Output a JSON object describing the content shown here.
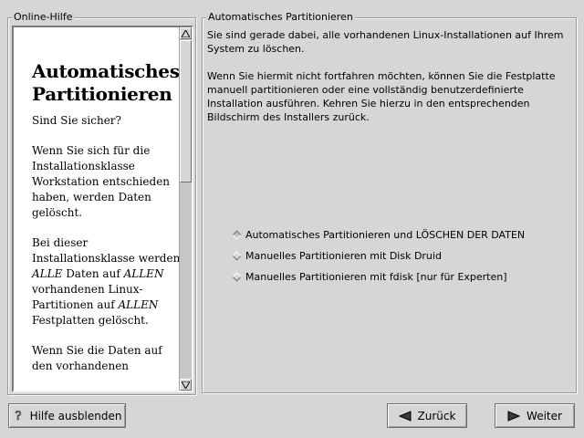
{
  "help": {
    "frame_title": "Online-Hilfe",
    "heading_line1": "Automatisches",
    "heading_line2": "Partitionieren",
    "p1": "Sind Sie sicher?",
    "p2": "Wenn Sie sich für die Installationsklasse Workstation entschieden haben, werden Daten gelöscht.",
    "p3_a": "Bei dieser Installationsklasse werden ",
    "p3_b": "ALLE",
    "p3_c": " Daten auf ",
    "p3_d": "ALLEN",
    "p3_e": " vorhandenen Linux-Partitionen auf ",
    "p3_f": "ALLEN",
    "p3_g": " Festplatten gelöscht.",
    "p4": "Wenn Sie die Daten auf den vorhandenen"
  },
  "main": {
    "frame_title": "Automatisches Partitionieren",
    "text1": "Sie sind gerade dabei, alle vorhandenen Linux-Installationen auf Ihrem System zu löschen.",
    "text2": "Wenn Sie hiermit nicht fortfahren möchten, können Sie die Festplatte manuell partitionieren oder eine vollständig benutzerdefinierte Installation ausführen. Kehren Sie hierzu in den entsprechenden Bildschirm des Installers zurück.",
    "options": [
      {
        "label": "Automatisches Partitionieren und LÖSCHEN DER DATEN",
        "selected": true
      },
      {
        "label": "Manuelles Partitionieren mit Disk Druid",
        "selected": false
      },
      {
        "label": "Manuelles Partitionieren mit fdisk [nur für Experten]",
        "selected": false
      }
    ]
  },
  "buttons": {
    "hide_help": "Hilfe ausblenden",
    "back": "Zurück",
    "next": "Weiter"
  },
  "icons": {
    "hide_help": "question-mark-icon",
    "back": "arrow-left-icon",
    "next": "arrow-right-icon"
  }
}
